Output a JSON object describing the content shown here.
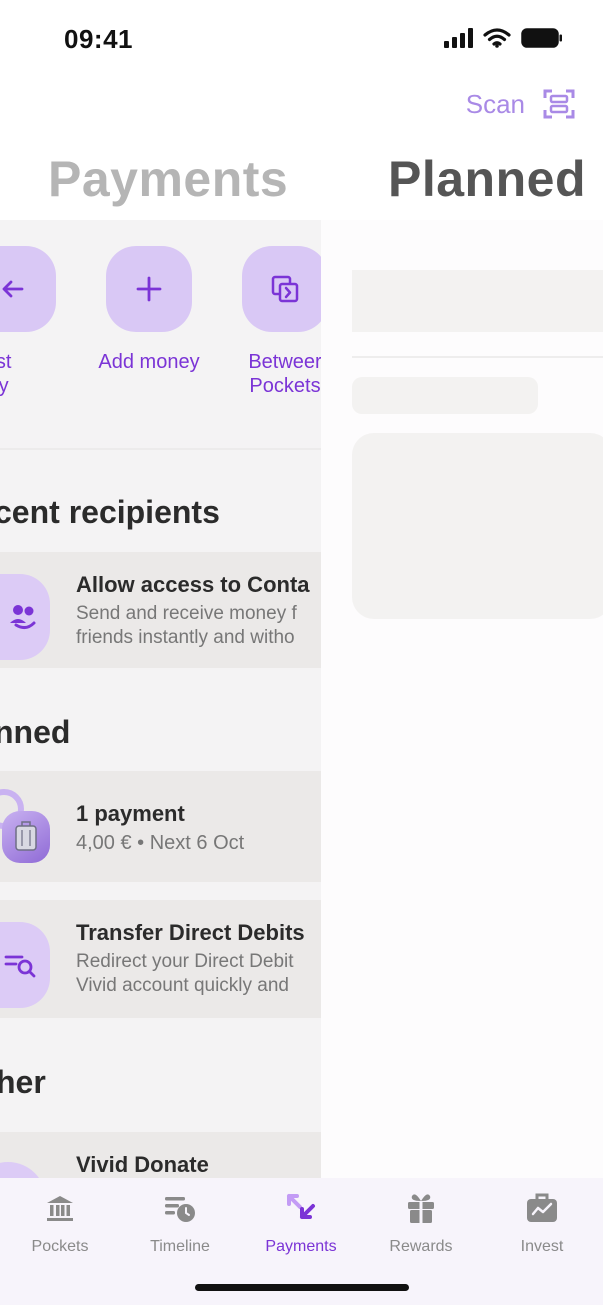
{
  "status": {
    "time": "09:41"
  },
  "header": {
    "scan_label": "Scan",
    "title_left": "Payments",
    "title_right": "Planned"
  },
  "actions": [
    {
      "line1": "quest",
      "line2": "oney",
      "icon": "arrow-left-icon"
    },
    {
      "line1": "Add money",
      "line2": "",
      "icon": "plus-icon"
    },
    {
      "line1": "Betweer",
      "line2": "Pockets",
      "icon": "between-pockets-icon"
    }
  ],
  "sections": {
    "recent": "cent recipients",
    "planned": "nned",
    "other": "her"
  },
  "contacts_card": {
    "title": "Allow access to Conta",
    "line1": "Send and receive money f",
    "line2": "friends instantly and witho"
  },
  "planned_card": {
    "title": "1 payment",
    "subtitle": "4,00 € • Next 6 Oct"
  },
  "debits_card": {
    "title": "Transfer Direct Debits",
    "line1": "Redirect your Direct Debit",
    "line2": "Vivid account quickly and"
  },
  "donate_card": {
    "title": "Vivid Donate"
  },
  "tabs": [
    {
      "label": "Pockets",
      "icon": "bank-icon",
      "active": false
    },
    {
      "label": "Timeline",
      "icon": "timeline-clock-icon",
      "active": false
    },
    {
      "label": "Payments",
      "icon": "payments-arrows-icon",
      "active": true
    },
    {
      "label": "Rewards",
      "icon": "gift-icon",
      "active": false
    },
    {
      "label": "Invest",
      "icon": "briefcase-chart-icon",
      "active": false
    }
  ],
  "colors": {
    "accent": "#7b34d6",
    "accent_light": "#d9c8f5",
    "scan": "#a98ae6"
  }
}
